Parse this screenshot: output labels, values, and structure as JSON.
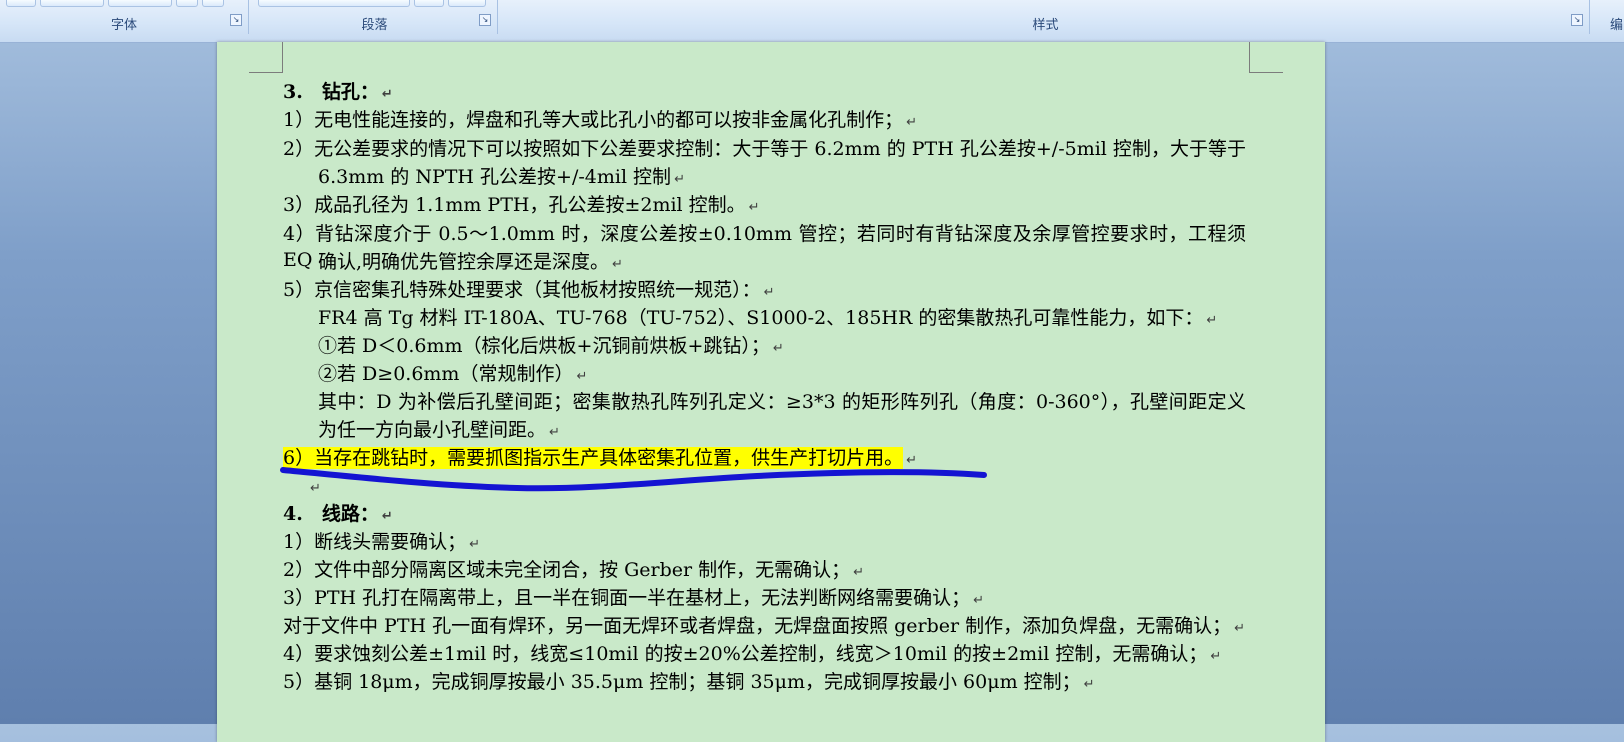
{
  "ribbon": {
    "groups": [
      "字体",
      "段落",
      "样式",
      "编"
    ]
  },
  "document": {
    "pilcrow": "↵",
    "lines": [
      {
        "kind": "heading",
        "text": "3.　钻孔："
      },
      {
        "kind": "item",
        "text": "1）无电性能连接的，焊盘和孔等大或比孔小的都可以按非金属化孔制作；"
      },
      {
        "kind": "item",
        "text": "2）无公差要求的情况下可以按照如下公差要求控制：大于等于 6.2mm 的 PTH 孔公差按+/-5mil 控制，大于等于"
      },
      {
        "kind": "cont",
        "text": "6.3mm 的 NPTH 孔公差按+/-4mil 控制"
      },
      {
        "kind": "item",
        "text": "3）成品孔径为 1.1mm PTH，孔公差按±2mil 控制。"
      },
      {
        "kind": "item",
        "text": "4）背钻深度介于 0.5～1.0mm 时，深度公差按±0.10mm 管控；若同时有背钻深度及余厚管控要求时，工程须 EQ"
      },
      {
        "kind": "cont",
        "text": "确认,明确优先管控余厚还是深度。"
      },
      {
        "kind": "item",
        "text": "5）京信密集孔特殊处理要求（其他板材按照统一规范）："
      },
      {
        "kind": "cont",
        "text": "FR4 高 Tg 材料 IT-180A、TU-768（TU-752）、S1000-2、185HR 的密集散热孔可靠性能力，如下："
      },
      {
        "kind": "cont",
        "text": "①若 D＜0.6mm（棕化后烘板+沉铜前烘板+跳钻）；"
      },
      {
        "kind": "cont",
        "text": "②若 D≥0.6mm（常规制作）"
      },
      {
        "kind": "cont",
        "text": "其中：D 为补偿后孔壁间距；密集散热孔阵列孔定义：≥3*3 的矩形阵列孔（角度：0-360°），孔壁间距定义"
      },
      {
        "kind": "cont",
        "text": "为任一方向最小孔壁间距。"
      },
      {
        "kind": "highlight",
        "text": "6）当存在跳钻时，需要抓图指示生产具体密集孔位置，供生产打切片用。"
      },
      {
        "kind": "blank",
        "text": ""
      },
      {
        "kind": "heading",
        "text": "4.　线路："
      },
      {
        "kind": "item",
        "text": "1）断线头需要确认；"
      },
      {
        "kind": "item",
        "text": "2）文件中部分隔离区域未完全闭合，按 Gerber 制作，无需确认；"
      },
      {
        "kind": "item",
        "text": "3）PTH 孔打在隔离带上，且一半在铜面一半在基材上，无法判断网络需要确认；"
      },
      {
        "kind": "plain",
        "text": "对于文件中 PTH 孔一面有焊环，另一面无焊环或者焊盘，无焊盘面按照 gerber 制作，添加负焊盘，无需确认；"
      },
      {
        "kind": "item",
        "text": "4）要求蚀刻公差±1mil 时，线宽≤10mil 的按±20%公差控制，线宽＞10mil 的按±2mil 控制，无需确认；"
      },
      {
        "kind": "item",
        "text": "5）基铜 18μm，完成铜厚按最小 35.5μm 控制；基铜 35μm，完成铜厚按最小 60μm 控制；"
      }
    ]
  },
  "colors": {
    "page_bg": "#c9e9c9",
    "highlight": "#ffff00",
    "ink_stroke": "#1414d2"
  }
}
